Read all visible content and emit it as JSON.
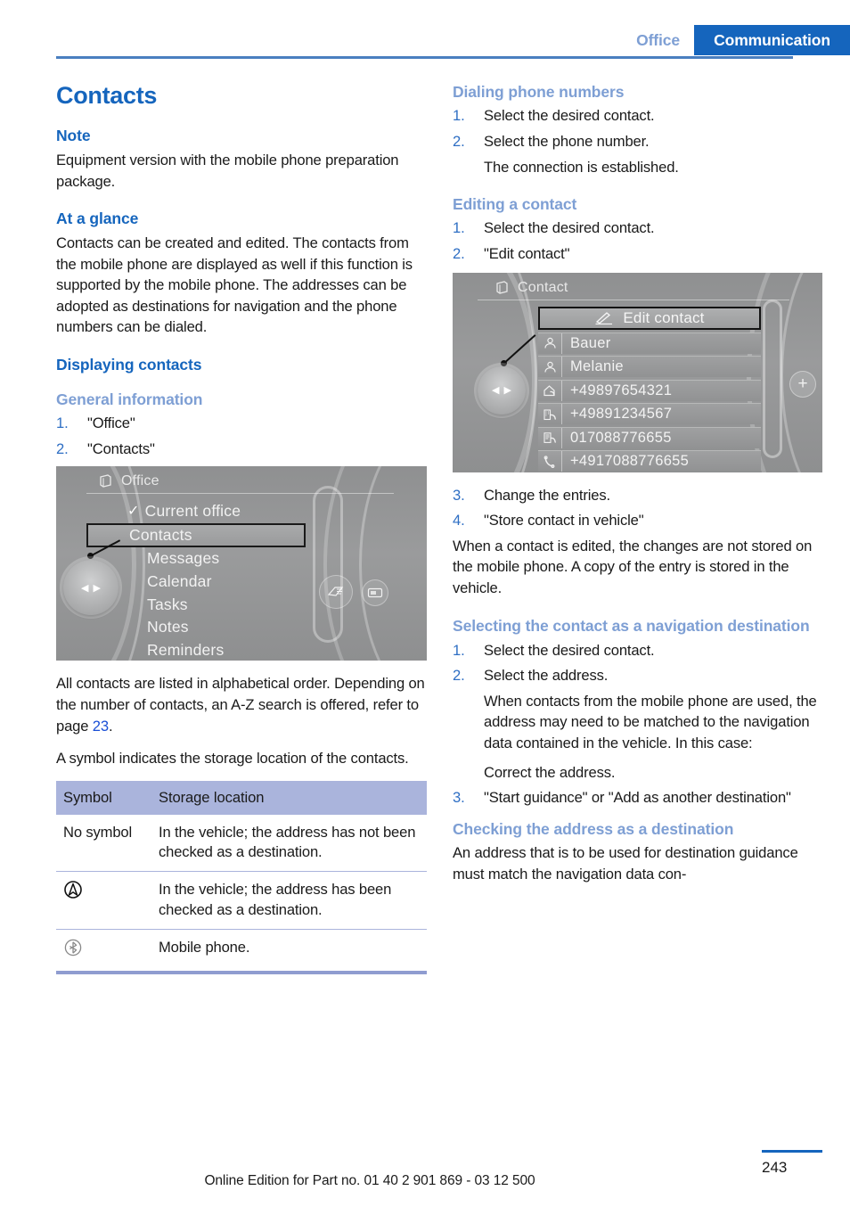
{
  "header": {
    "tab_inactive": "Office",
    "tab_active": "Communication",
    "accent_blue": "#1565bd",
    "light_blue": "#7e9fd4"
  },
  "left_column": {
    "title": "Contacts",
    "note_heading": "Note",
    "note_body": "Equipment version with the mobile phone preparation package.",
    "at_a_glance_heading": "At a glance",
    "at_a_glance_body": "Contacts can be created and edited. The contacts from the mobile phone are displayed as well if this function is supported by the mobile phone. The addresses can be adopted as destinations for navigation and the phone numbers can be dialed.",
    "displaying_contacts_heading": "Displaying contacts",
    "general_information_heading": "General information",
    "general_steps": [
      {
        "num": "1.",
        "text": "\"Office\""
      },
      {
        "num": "2.",
        "text": "\"Contacts\""
      }
    ],
    "idrive_office": {
      "title": "Office",
      "title_icon": "book-icon",
      "items": [
        {
          "label": "Current office",
          "checked": true,
          "selected": false
        },
        {
          "label": "Contacts",
          "checked": false,
          "selected": true
        },
        {
          "label": "Messages",
          "checked": false,
          "selected": false
        },
        {
          "label": "Calendar",
          "checked": false,
          "selected": false
        },
        {
          "label": "Tasks",
          "checked": false,
          "selected": false
        },
        {
          "label": "Notes",
          "checked": false,
          "selected": false
        },
        {
          "label": "Reminders",
          "checked": false,
          "selected": false
        }
      ]
    },
    "after_image_body_1": "All contacts are listed in alphabetical order. Depending on the number of contacts, an A-Z search is offered, refer to page ",
    "after_image_pageref": "23",
    "after_image_body_1_end": ".",
    "after_image_body_2": "A symbol indicates the storage location of the contacts.",
    "table": {
      "headers": [
        "Symbol",
        "Storage location"
      ],
      "rows": [
        {
          "symbol_text": "No symbol",
          "symbol_icon": "",
          "description": "In the vehicle; the address has not been checked as a destination."
        },
        {
          "symbol_text": "",
          "symbol_icon": "navigation-arrow-circle-icon",
          "description": "In the vehicle; the address has been checked as a destination."
        },
        {
          "symbol_text": "",
          "symbol_icon": "bluetooth-circle-icon",
          "description": "Mobile phone."
        }
      ]
    }
  },
  "right_column": {
    "dialing_heading": "Dialing phone numbers",
    "dialing_steps": [
      {
        "num": "1.",
        "text": "Select the desired contact."
      },
      {
        "num": "2.",
        "text": "Select the phone number."
      }
    ],
    "dialing_substep": "The connection is established.",
    "editing_heading": "Editing a contact",
    "editing_steps_top": [
      {
        "num": "1.",
        "text": "Select the desired contact."
      },
      {
        "num": "2.",
        "text": "\"Edit contact\""
      }
    ],
    "idrive_contact": {
      "title": "Contact",
      "title_icon": "book-icon",
      "edit_row": {
        "label": "Edit contact",
        "icon": "pencil-icon"
      },
      "rows": [
        {
          "icon": "person-icon",
          "label": "Bauer"
        },
        {
          "icon": "person-icon",
          "label": "Melanie"
        },
        {
          "icon": "home-phone-icon",
          "label": "+49897654321"
        },
        {
          "icon": "office-phone-icon",
          "label": "+49891234567"
        },
        {
          "icon": "fax-icon",
          "label": "017088776655"
        },
        {
          "icon": "mobile-phone-icon",
          "label": "+4917088776655"
        }
      ],
      "plus_button": "+"
    },
    "editing_steps_bottom": [
      {
        "num": "3.",
        "text": "Change the entries."
      },
      {
        "num": "4.",
        "text": "\"Store contact in vehicle\""
      }
    ],
    "editing_body": "When a contact is edited, the changes are not stored on the mobile phone. A copy of the entry is stored in the vehicle.",
    "selecting_heading": "Selecting the contact as a navigation destination",
    "selecting_steps_top": [
      {
        "num": "1.",
        "text": "Select the desired contact."
      },
      {
        "num": "2.",
        "text": "Select the address."
      }
    ],
    "selecting_substep_1": "When contacts from the mobile phone are used, the address may need to be matched to the navigation data contained in the vehicle. In this case:",
    "selecting_substep_2": "Correct the address.",
    "selecting_step_3": {
      "num": "3.",
      "text": "\"Start guidance\" or \"Add as another destination\""
    },
    "checking_heading": "Checking the address as a destination",
    "checking_body": "An address that is to be used for destination guidance must match the navigation data con-"
  },
  "footer": {
    "text": "Online Edition for Part no. 01 40 2 901 869 - 03 12 500",
    "page_number": "243"
  }
}
